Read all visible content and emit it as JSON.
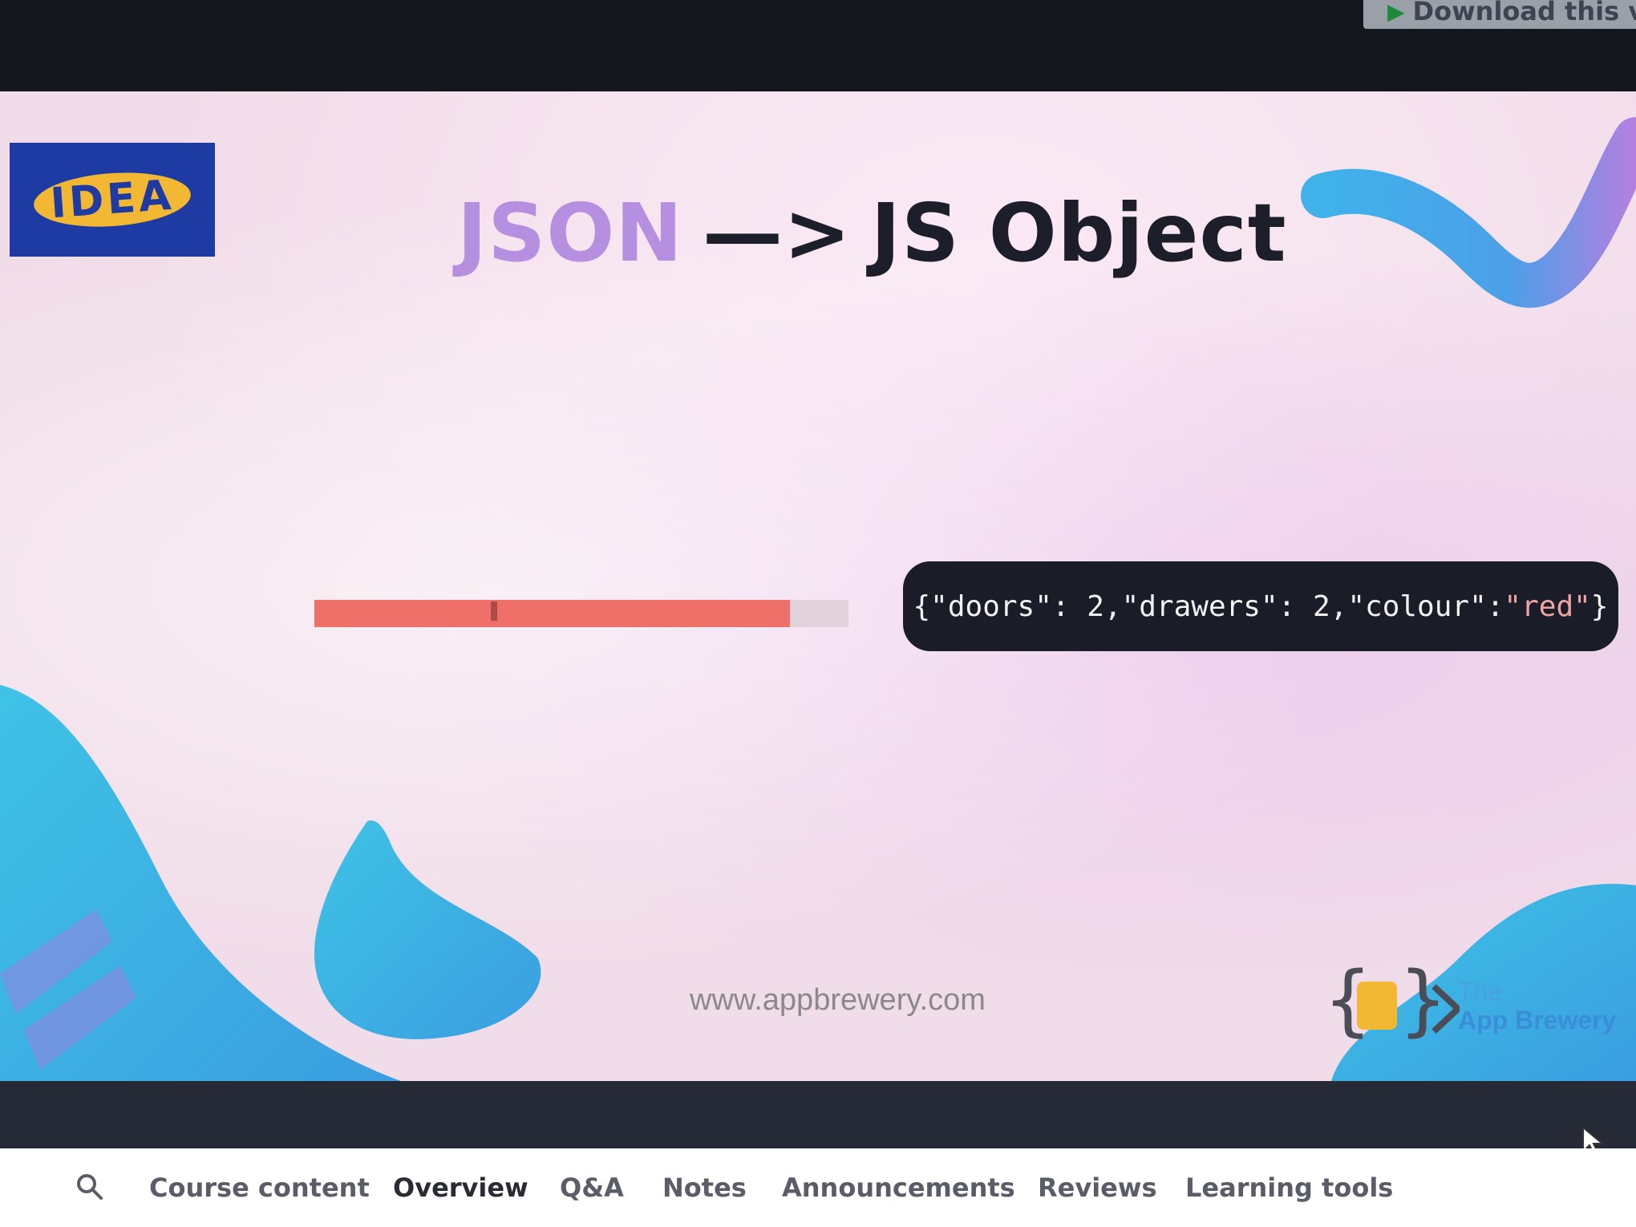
{
  "download": {
    "label": "Download this video",
    "icon": "play-icon"
  },
  "slide": {
    "logo_text": "IDEA",
    "title_part1": "JSON",
    "title_arrow": "—>",
    "title_part2": "JS Object",
    "code_prefix": "{\"doors\": 2,\"drawers\": 2,\"colour\":",
    "code_value": "\"red\"",
    "code_suffix": "}",
    "url": "www.appbrewery.com",
    "brand_the": "The",
    "brand_name": "App Brewery"
  },
  "player": {
    "progress": 0.89,
    "marker": 0.33
  },
  "tabs": [
    {
      "label": "Course content"
    },
    {
      "label": "Overview"
    },
    {
      "label": "Q&A"
    },
    {
      "label": "Notes"
    },
    {
      "label": "Announcements"
    },
    {
      "label": "Reviews"
    },
    {
      "label": "Learning tools"
    }
  ],
  "colors": {
    "accent_purple": "#b68fe0",
    "logo_blue": "#1e3aa3",
    "logo_yellow": "#f2b733",
    "progress": "#ee7068"
  }
}
